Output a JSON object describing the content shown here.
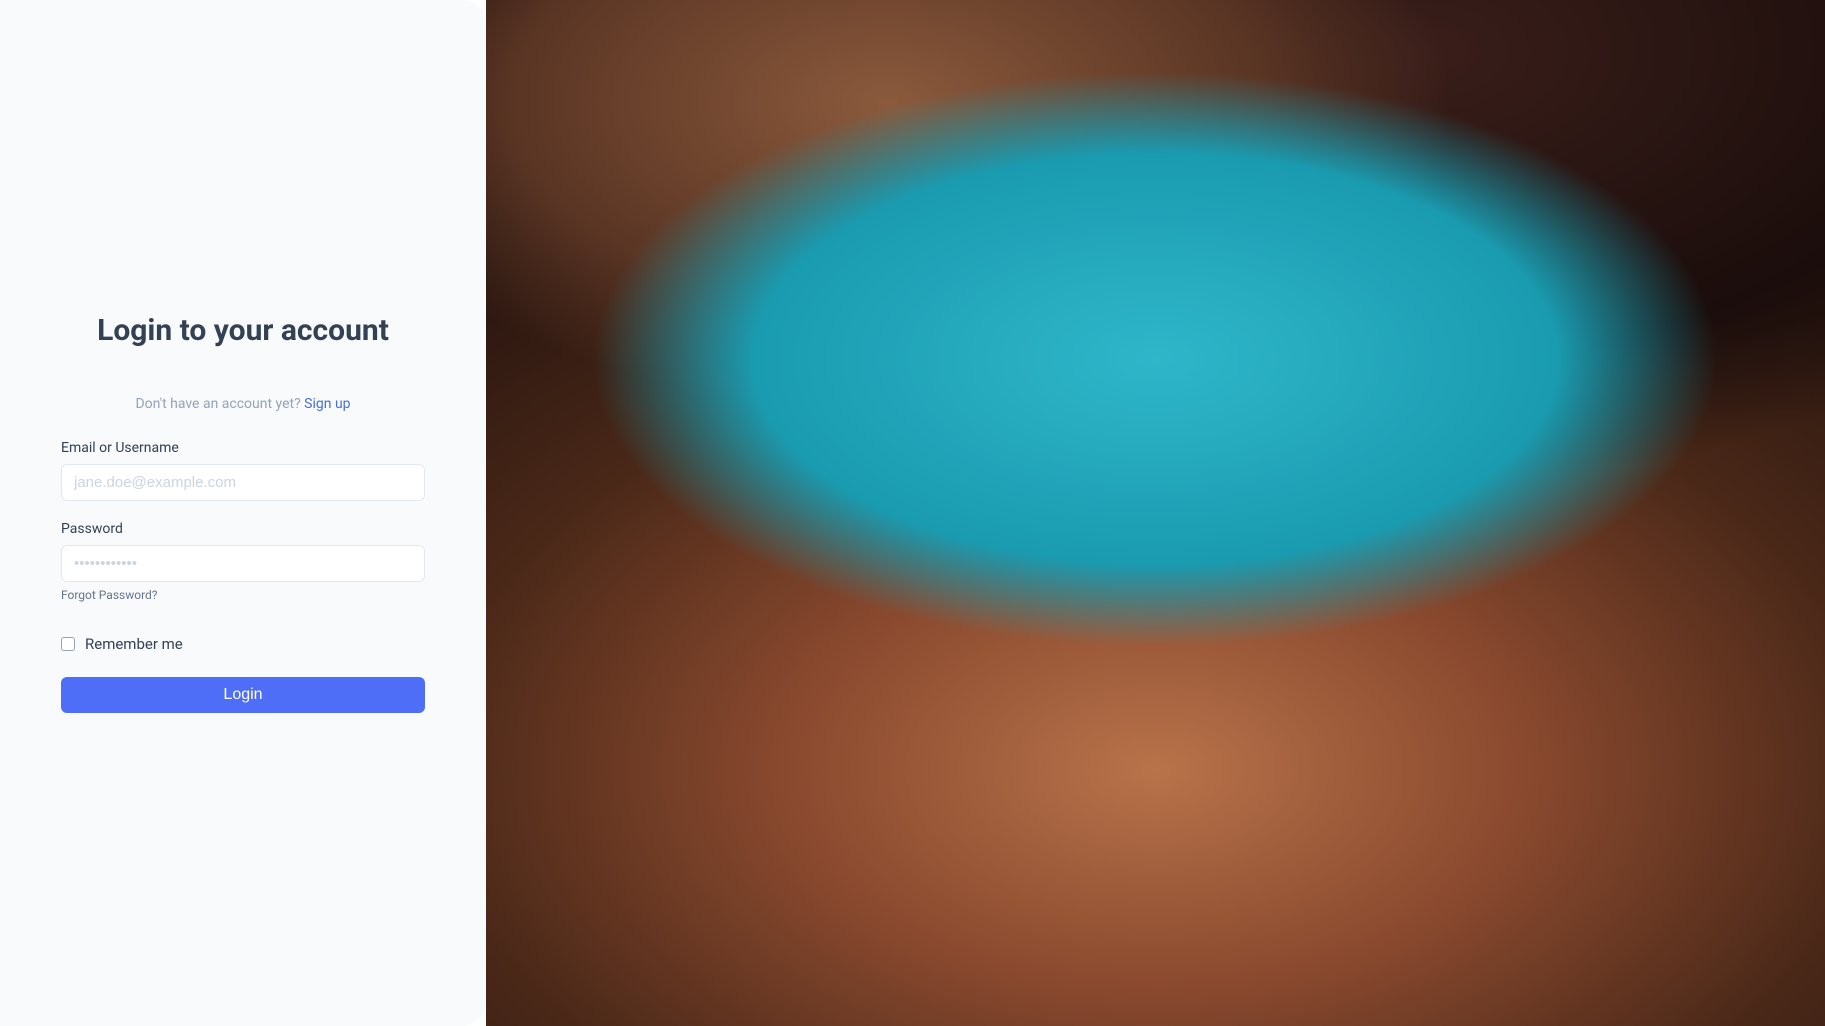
{
  "login": {
    "title": "Login to your account",
    "signup_prompt": "Don't have an account yet? ",
    "signup_link": "Sign up",
    "email_label": "Email or Username",
    "email_placeholder": "jane.doe@example.com",
    "email_value": "",
    "password_label": "Password",
    "password_placeholder": "••••••••••••",
    "password_value": "",
    "forgot_password": "Forgot Password?",
    "remember_label": "Remember me",
    "remember_checked": false,
    "submit_label": "Login"
  },
  "colors": {
    "accent": "#4f6ef7",
    "panel_bg": "#f8fafc",
    "text_primary": "#334155",
    "text_muted": "#94a3b8"
  }
}
